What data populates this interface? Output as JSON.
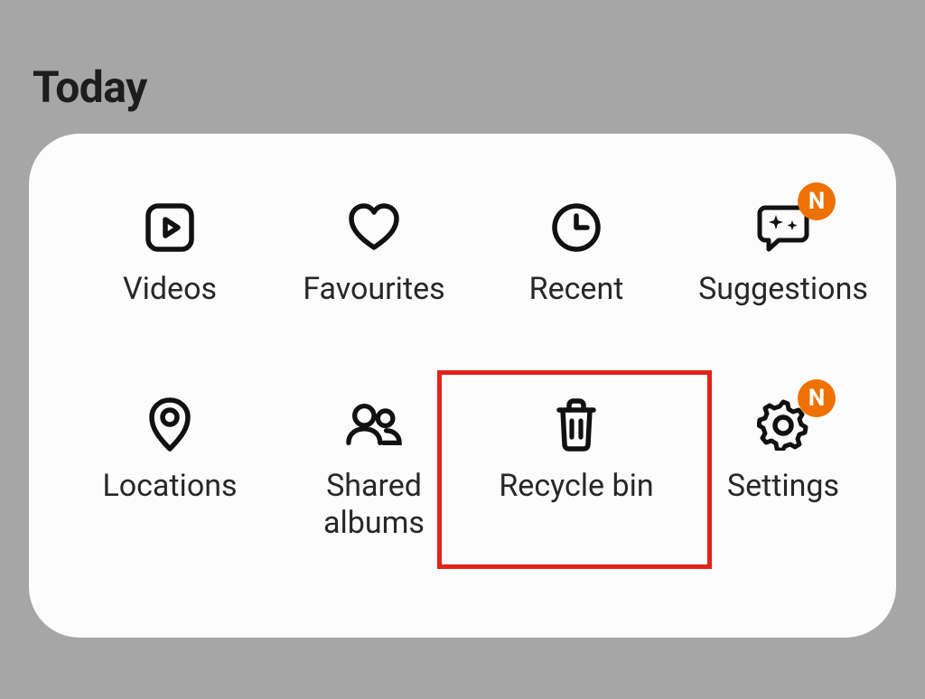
{
  "title": "Today",
  "badge_text": "N",
  "colors": {
    "accent": "#ed7203",
    "highlight": "#e2231a"
  },
  "tiles": {
    "videos": {
      "label": "Videos"
    },
    "favourites": {
      "label": "Favourites"
    },
    "recent": {
      "label": "Recent"
    },
    "suggestions": {
      "label": "Suggestions"
    },
    "locations": {
      "label": "Locations"
    },
    "shared": {
      "label": "Shared\nalbums"
    },
    "recycle": {
      "label": "Recycle bin"
    },
    "settings": {
      "label": "Settings"
    }
  }
}
